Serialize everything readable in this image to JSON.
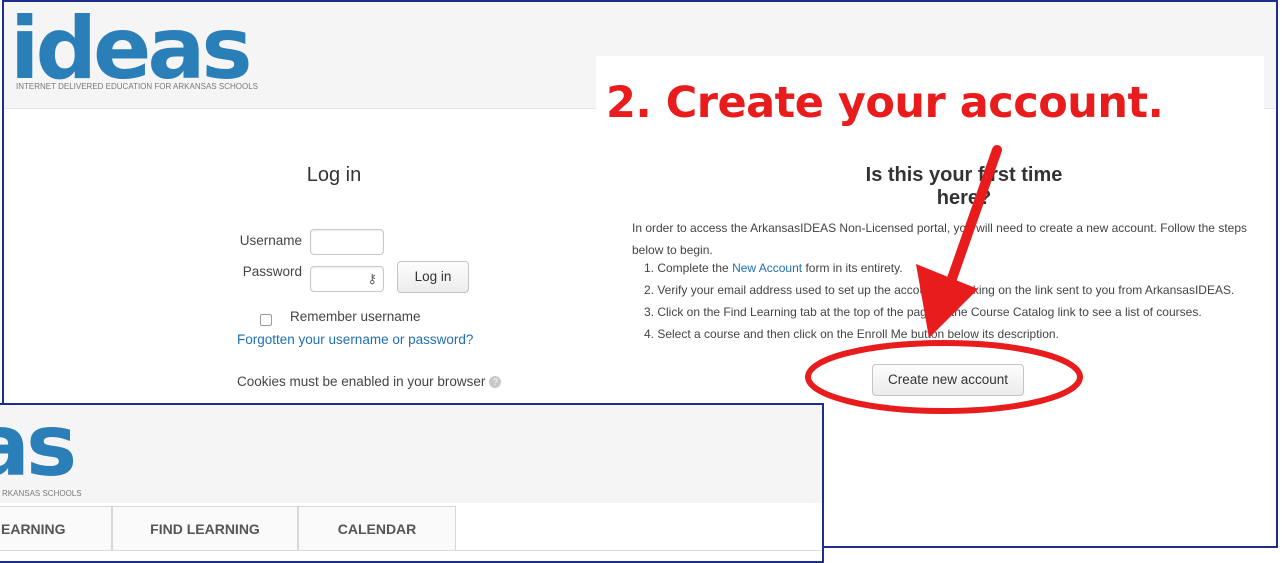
{
  "brand": {
    "logo_text": "ideas",
    "tagline": "INTERNET DELIVERED EDUCATION FOR ARKANSAS SCHOOLS",
    "logo_color": "#2b7fb8"
  },
  "annotation": {
    "title": "2. Create your account.",
    "color": "#e81c1c"
  },
  "login": {
    "title": "Log in",
    "username_label": "Username",
    "password_label": "Password",
    "login_button": "Log in",
    "remember_label": "Remember username",
    "forgot_link": "Forgotten your username or password?",
    "cookies_note": "Cookies must be enabled in your browser"
  },
  "signup": {
    "title": "Is this your first time here?",
    "intro": "In order to access the ArkansasIDEAS Non-Licensed portal, you will need to create a new account. Follow the steps below to begin.",
    "steps": [
      {
        "pre": "1. Complete the ",
        "link": "New Account",
        "post": " form in its entirety."
      },
      {
        "pre": "2. Verify your email address used to set up the account by clicking on the link sent to you from ArkansasIDEAS.",
        "link": "",
        "post": ""
      },
      {
        "pre": "3. Click on the Find Learning tab at the top of the page or the Course Catalog link to see a list of courses.",
        "link": "",
        "post": ""
      },
      {
        "pre": "4. Select a course and then click on the Enroll Me button below its description.",
        "link": "",
        "post": ""
      }
    ],
    "create_button": "Create new account"
  },
  "overlay": {
    "logo_text": "as",
    "tagline": "RKANSAS SCHOOLS",
    "tabs": [
      "EARNING",
      "FIND LEARNING",
      "CALENDAR"
    ]
  }
}
